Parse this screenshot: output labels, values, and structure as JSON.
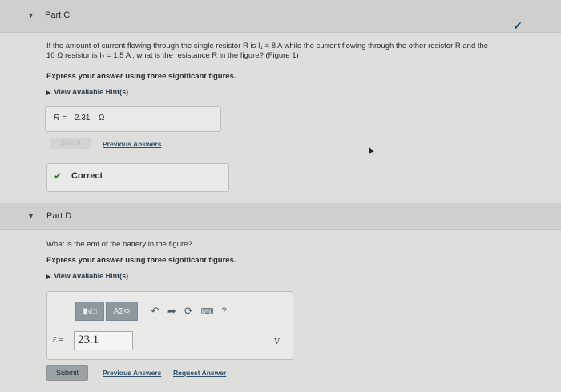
{
  "part_c": {
    "title": "Part C",
    "question_line1": "If the amount of current flowing through the single resistor R is I₁ = 8 A while the current flowing through the other resistor R and the",
    "question_line2": "10 Ω resistor is I₂ = 1.5 A , what is the resistance R in the figure? (Figure 1)",
    "instruction": "Express your answer using three significant figures.",
    "hints_label": "View Available Hint(s)",
    "answer_var": "R =",
    "answer_value": "2.31",
    "answer_unit": "Ω",
    "submit_label": "Submit",
    "previous_answers_label": "Previous Answers",
    "feedback": "Correct"
  },
  "part_d": {
    "title": "Part D",
    "question": "What is the emf of the battery in the figure?",
    "instruction": "Express your answer using three significant figures.",
    "hints_label": "View Available Hint(s)",
    "toolbar_symbols_label": "ΑΣΦ",
    "answer_var": "Ɛ =",
    "answer_value": "23.1",
    "answer_unit": "V",
    "submit_label": "Submit",
    "previous_answers_label": "Previous Answers",
    "request_answer_label": "Request Answer"
  },
  "icons": [
    "check-icon",
    "caret-down-icon",
    "undo-icon",
    "redo-icon",
    "reset-icon",
    "keyboard-icon",
    "help-icon",
    "templates-icon"
  ],
  "colors": {
    "check": "#1f4e73",
    "correct_check": "#2f6f2f",
    "submit": "#9aa2a6"
  }
}
